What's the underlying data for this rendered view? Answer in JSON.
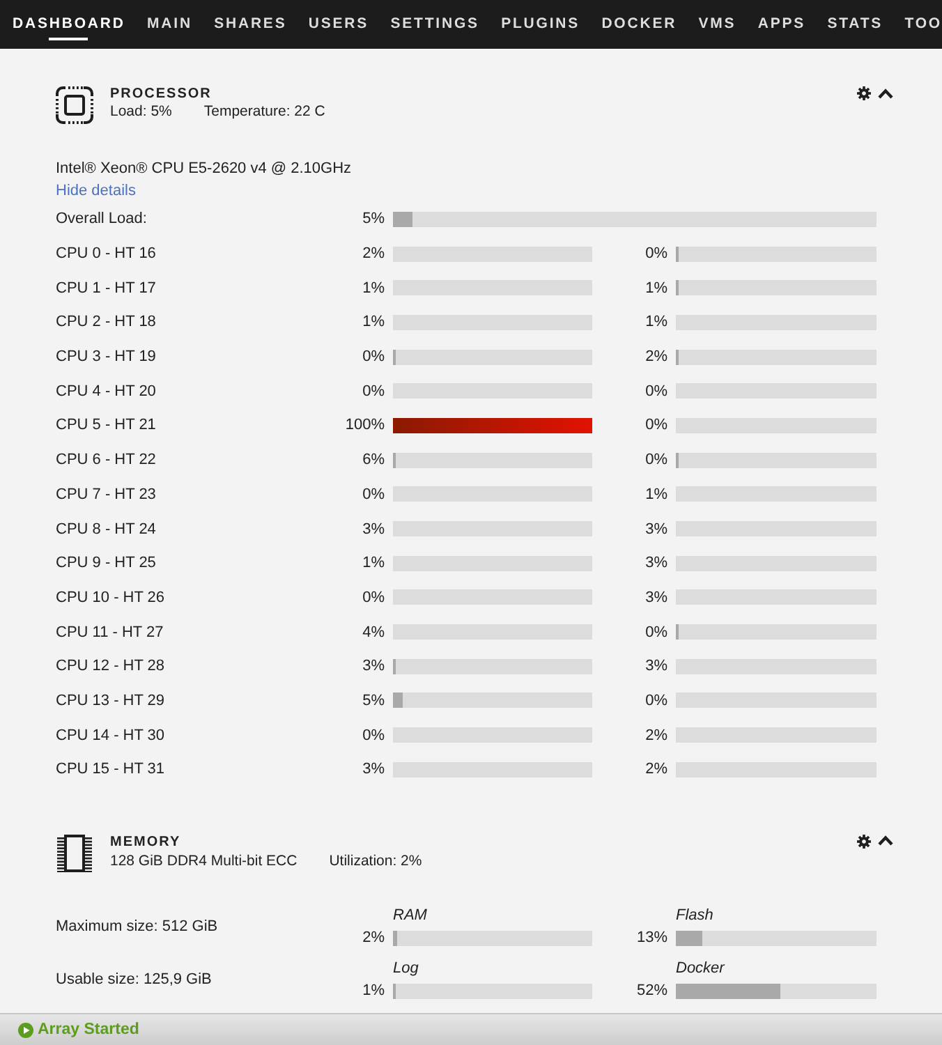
{
  "nav": {
    "items": [
      {
        "label": "DASHBOARD",
        "selected": true
      },
      {
        "label": "MAIN",
        "selected": false
      },
      {
        "label": "SHARES",
        "selected": false
      },
      {
        "label": "USERS",
        "selected": false
      },
      {
        "label": "SETTINGS",
        "selected": false
      },
      {
        "label": "PLUGINS",
        "selected": false
      },
      {
        "label": "DOCKER",
        "selected": false
      },
      {
        "label": "VMS",
        "selected": false
      },
      {
        "label": "APPS",
        "selected": false
      },
      {
        "label": "STATS",
        "selected": false
      },
      {
        "label": "TOO",
        "selected": false
      }
    ]
  },
  "processor": {
    "title": "PROCESSOR",
    "load": "Load: 5%",
    "temperature": "Temperature: 22 C",
    "model": "Intel® Xeon® CPU E5-2620 v4 @ 2.10GHz",
    "details_link": "Hide details",
    "overall": {
      "label": "Overall Load:",
      "reading": "5%",
      "level": 0.04
    },
    "cores": [
      {
        "label": "CPU 0 - HT 16",
        "threads": [
          {
            "reading": "2%",
            "level": 0
          },
          {
            "reading": "0%",
            "level": 0.015
          }
        ]
      },
      {
        "label": "CPU 1 - HT 17",
        "threads": [
          {
            "reading": "1%",
            "level": 0
          },
          {
            "reading": "1%",
            "level": 0.015
          }
        ]
      },
      {
        "label": "CPU 2 - HT 18",
        "threads": [
          {
            "reading": "1%",
            "level": 0
          },
          {
            "reading": "1%",
            "level": 0
          }
        ]
      },
      {
        "label": "CPU 3 - HT 19",
        "threads": [
          {
            "reading": "0%",
            "level": 0.015
          },
          {
            "reading": "2%",
            "level": 0.015
          }
        ]
      },
      {
        "label": "CPU 4 - HT 20",
        "threads": [
          {
            "reading": "0%",
            "level": 0
          },
          {
            "reading": "0%",
            "level": 0
          }
        ]
      },
      {
        "label": "CPU 5 - HT 21",
        "threads": [
          {
            "reading": "100%",
            "level": 1
          },
          {
            "reading": "0%",
            "level": 0
          }
        ]
      },
      {
        "label": "CPU 6 - HT 22",
        "threads": [
          {
            "reading": "6%",
            "level": 0.015
          },
          {
            "reading": "0%",
            "level": 0.015
          }
        ]
      },
      {
        "label": "CPU 7 - HT 23",
        "threads": [
          {
            "reading": "0%",
            "level": 0
          },
          {
            "reading": "1%",
            "level": 0
          }
        ]
      },
      {
        "label": "CPU 8 - HT 24",
        "threads": [
          {
            "reading": "3%",
            "level": 0
          },
          {
            "reading": "3%",
            "level": 0
          }
        ]
      },
      {
        "label": "CPU 9 - HT 25",
        "threads": [
          {
            "reading": "1%",
            "level": 0
          },
          {
            "reading": "3%",
            "level": 0
          }
        ]
      },
      {
        "label": "CPU 10 - HT 26",
        "threads": [
          {
            "reading": "0%",
            "level": 0
          },
          {
            "reading": "3%",
            "level": 0
          }
        ]
      },
      {
        "label": "CPU 11 - HT 27",
        "threads": [
          {
            "reading": "4%",
            "level": 0
          },
          {
            "reading": "0%",
            "level": 0.015
          }
        ]
      },
      {
        "label": "CPU 12 - HT 28",
        "threads": [
          {
            "reading": "3%",
            "level": 0.015
          },
          {
            "reading": "3%",
            "level": 0
          }
        ]
      },
      {
        "label": "CPU 13 - HT 29",
        "threads": [
          {
            "reading": "5%",
            "level": 0.05
          },
          {
            "reading": "0%",
            "level": 0
          }
        ]
      },
      {
        "label": "CPU 14 - HT 30",
        "threads": [
          {
            "reading": "0%",
            "level": 0
          },
          {
            "reading": "2%",
            "level": 0
          }
        ]
      },
      {
        "label": "CPU 15 - HT 31",
        "threads": [
          {
            "reading": "3%",
            "level": 0
          },
          {
            "reading": "2%",
            "level": 0
          }
        ]
      }
    ]
  },
  "memory": {
    "title": "MEMORY",
    "description": "128 GiB DDR4 Multi-bit ECC",
    "utilization": "Utilization: 2%",
    "rows": [
      {
        "label": "Maximum size: 512 GiB",
        "meters": [
          {
            "name": "RAM",
            "reading": "2%",
            "level": 0.02
          },
          {
            "name": "Flash",
            "reading": "13%",
            "level": 0.13
          }
        ]
      },
      {
        "label": "Usable size: 125,9 GiB",
        "meters": [
          {
            "name": "Log",
            "reading": "1%",
            "level": 0.015
          },
          {
            "name": "Docker",
            "reading": "52%",
            "level": 0.52
          }
        ]
      }
    ]
  },
  "status_bar": {
    "text": "Array Started"
  }
}
